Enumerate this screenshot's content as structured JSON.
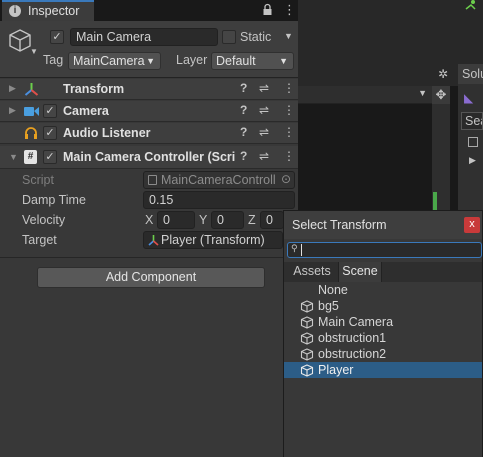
{
  "window": {
    "tab_title": "Inspector",
    "info_icon": "info-icon",
    "lock_icon": "lock-icon",
    "menu_icon": "kebab-menu-icon"
  },
  "header": {
    "game_object_name": "Main Camera",
    "static_label": "Static",
    "tag_label": "Tag",
    "tag_value": "MainCamera",
    "layer_label": "Layer",
    "layer_value": "Default"
  },
  "components": [
    {
      "name": "Transform",
      "icon": "transform-icon",
      "checkbox": false
    },
    {
      "name": "Camera",
      "icon": "camera-icon",
      "checkbox": true
    },
    {
      "name": "Audio Listener",
      "icon": "headphones-icon",
      "checkbox": true
    },
    {
      "name": "Main Camera Controller (Scrip",
      "icon": "script-icon",
      "checkbox": true
    }
  ],
  "controller": {
    "script_label": "Script",
    "script_value": "MainCameraControll",
    "damp_label": "Damp Time",
    "damp_value": "0.15",
    "velocity_label": "Velocity",
    "x_label": "X",
    "x_value": "0",
    "y_label": "Y",
    "y_value": "0",
    "z_label": "Z",
    "z_value": "0",
    "target_label": "Target",
    "target_value": "Player (Transform)"
  },
  "add_component_label": "Add Component",
  "right_panel": {
    "tab_partial": "Solu",
    "search_partial": "Sea"
  },
  "popup": {
    "title": "Select Transform",
    "close_label": "x",
    "search_value": "",
    "tabs": [
      "Assets",
      "Scene"
    ],
    "active_tab": "Scene",
    "items": [
      {
        "label": "None",
        "icon": false,
        "selected": false
      },
      {
        "label": "bg5",
        "icon": true,
        "selected": false
      },
      {
        "label": "Main Camera",
        "icon": true,
        "selected": false
      },
      {
        "label": "obstruction1",
        "icon": true,
        "selected": false
      },
      {
        "label": "obstruction2",
        "icon": true,
        "selected": false
      },
      {
        "label": "Player",
        "icon": true,
        "selected": true
      }
    ]
  },
  "colors": {
    "selection": "#2c5d87",
    "accent_blue": "#3a79bb",
    "close_red": "#c83a3a",
    "scene_green": "#4aa84a"
  }
}
